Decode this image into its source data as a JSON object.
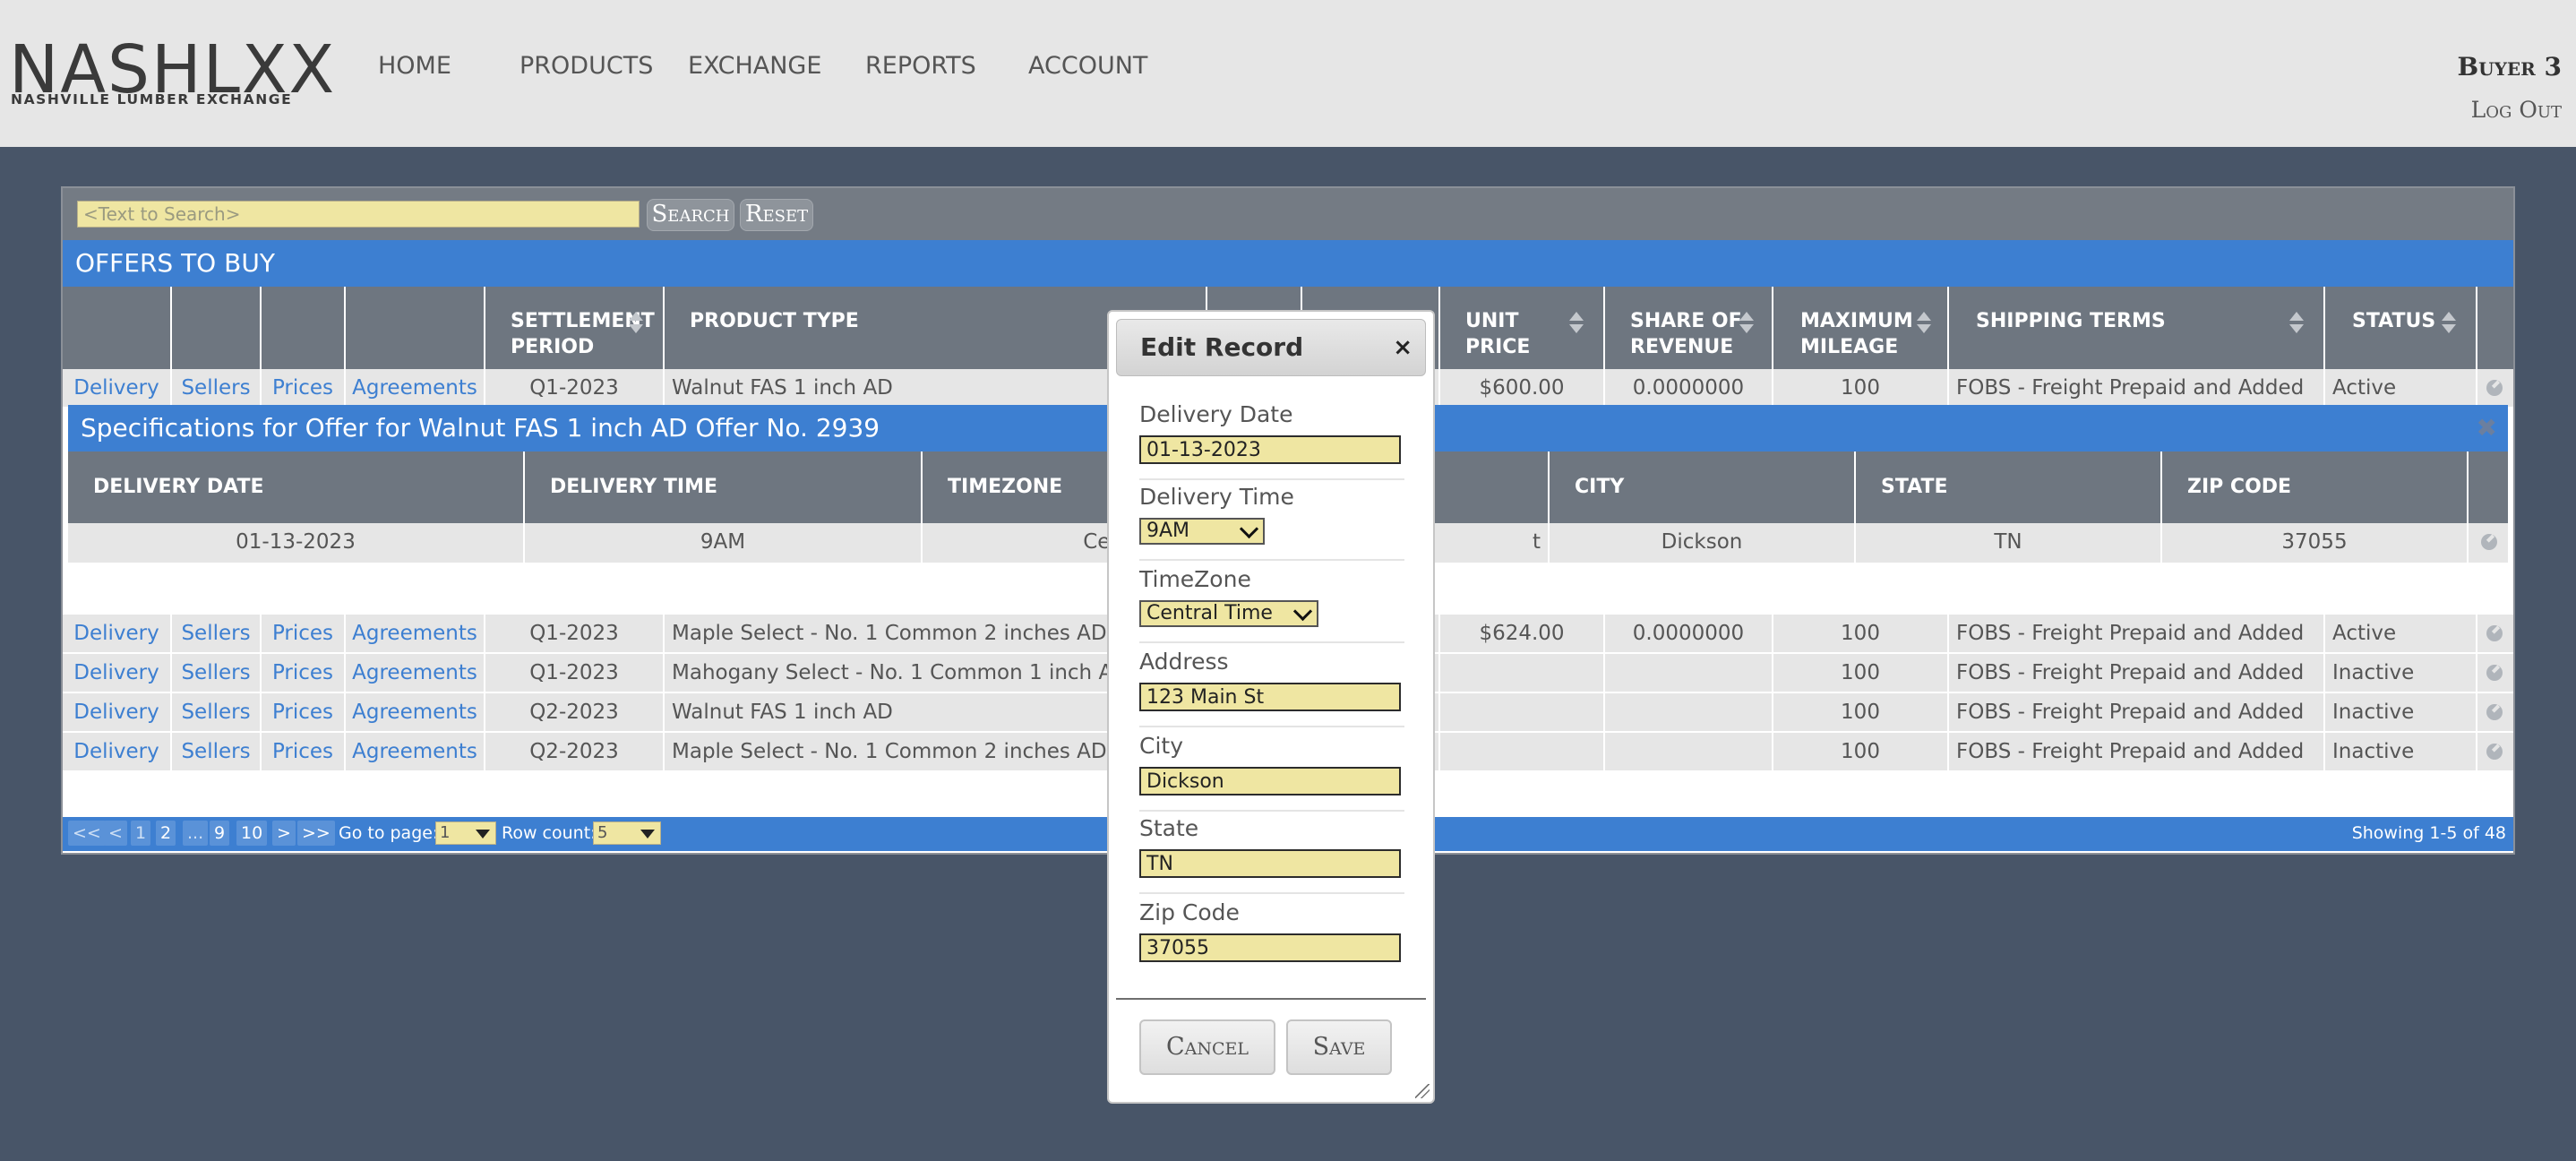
{
  "header": {
    "logo_text": "NASHLXX",
    "logo_subtext": "NASHVILLE LUMBER EXCHANGE",
    "nav": [
      "HOME",
      "PRODUCTS",
      "EXCHANGE",
      "REPORTS",
      "ACCOUNT"
    ],
    "user": "Buyer 3",
    "logout": "Log Out"
  },
  "search": {
    "placeholder": "<Text to Search>",
    "search_label": "Search",
    "reset_label": "Reset"
  },
  "offers": {
    "title": "OFFERS TO BUY",
    "columns": {
      "settlement_period": [
        "SETTLEMENT",
        "PERIOD"
      ],
      "product_type": "PRODUCT TYPE",
      "unit_price": [
        "UNIT",
        "PRICE"
      ],
      "share_of_revenue": [
        "SHARE OF",
        "REVENUE"
      ],
      "maximum_mileage": [
        "MAXIMUM",
        "MILEAGE"
      ],
      "shipping_terms": "SHIPPING TERMS",
      "status": "STATUS"
    },
    "row_links": [
      "Delivery",
      "Sellers",
      "Prices",
      "Agreements"
    ],
    "rows": [
      {
        "period": "Q1-2023",
        "product": "Walnut FAS 1 inch AD",
        "price": "$600.00",
        "share": "0.0000000",
        "mileage": "100",
        "terms": "FOBS - Freight Prepaid and Added",
        "status": "Active"
      },
      {
        "period": "Q1-2023",
        "product": "Maple Select - No. 1 Common 2 inches AD",
        "price": "$624.00",
        "share": "0.0000000",
        "mileage": "100",
        "terms": "FOBS - Freight Prepaid and Added",
        "status": "Active"
      },
      {
        "period": "Q1-2023",
        "product": "Mahogany Select - No. 1 Common 1 inch AD",
        "price": "",
        "share": "",
        "mileage": "100",
        "terms": "FOBS - Freight Prepaid and Added",
        "status": "Inactive"
      },
      {
        "period": "Q2-2023",
        "product": "Walnut FAS 1 inch AD",
        "price": "",
        "share": "",
        "mileage": "100",
        "terms": "FOBS - Freight Prepaid and Added",
        "status": "Inactive"
      },
      {
        "period": "Q2-2023",
        "product": "Maple Select - No. 1 Common 2 inches AD",
        "price": "",
        "share": "",
        "mileage": "100",
        "terms": "FOBS - Freight Prepaid and Added",
        "status": "Inactive"
      }
    ]
  },
  "specs": {
    "title": "Specifications for Offer for Walnut FAS 1 inch AD Offer No. 2939",
    "close": "✖",
    "columns": {
      "delivery_date": "DELIVERY DATE",
      "delivery_time": "DELIVERY TIME",
      "timezone": "TIMEZONE",
      "city": "CITY",
      "state": "STATE",
      "zip": "ZIP CODE"
    },
    "row": {
      "delivery_date": "01-13-2023",
      "delivery_time": "9AM",
      "timezone": "Central Ti",
      "address_tail": "t",
      "city": "Dickson",
      "state": "TN",
      "zip": "37055"
    }
  },
  "pager": {
    "buttons": [
      "<<",
      "<",
      "1",
      "2",
      "...",
      "9",
      "10",
      ">",
      ">>"
    ],
    "goto_label": "Go to page:",
    "goto_value": "1",
    "rowcount_label": "Row count:",
    "rowcount_value": "5",
    "showing": "Showing 1-5 of 48"
  },
  "modal": {
    "title": "Edit Record",
    "close": "×",
    "fields": {
      "delivery_date": {
        "label": "Delivery Date",
        "value": "01-13-2023"
      },
      "delivery_time": {
        "label": "Delivery Time",
        "value": "9AM"
      },
      "timezone": {
        "label": "TimeZone",
        "value": "Central Time"
      },
      "address": {
        "label": "Address",
        "value": "123 Main St"
      },
      "city": {
        "label": "City",
        "value": "Dickson"
      },
      "state": {
        "label": "State",
        "value": "TN"
      },
      "zip": {
        "label": "Zip Code",
        "value": "37055"
      }
    },
    "cancel": "Cancel",
    "save": "Save"
  },
  "colors": {
    "page_bg": "#485568",
    "header_bg": "#e6e6e6",
    "accent_blue": "#3d7fd1",
    "table_header": "#6e7680",
    "input_yellow": "#efe6a2"
  }
}
